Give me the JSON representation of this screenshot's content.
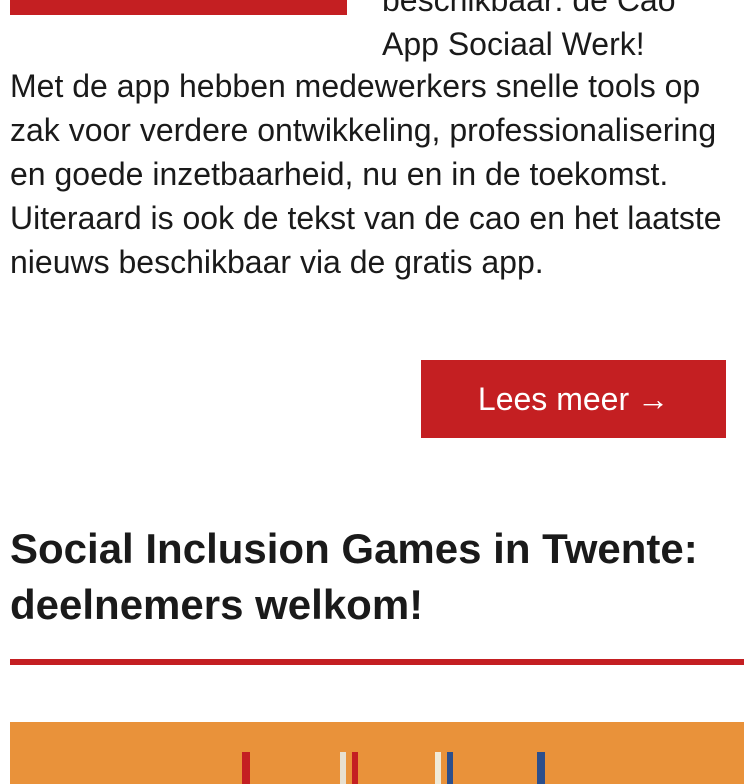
{
  "article_top": {
    "intro_line1": "beschikbaar: de Cao",
    "intro_line2": "App Sociaal Werk!",
    "body": "Met de app hebben medewerkers snelle tools op zak voor verdere ontwikkeling, professionalisering en goede inzetbaarheid, nu en in de toekomst. Uiteraard is ook de tekst van de cao en het laatste nieuws beschikbaar via de gratis app.",
    "read_more_label": "Lees meer",
    "read_more_arrow": "→"
  },
  "article_next": {
    "title": "Social Inclusion Games in Twente: deelnemers welkom!"
  },
  "colors": {
    "accent": "#c41f22",
    "image_bg": "#e9923a"
  },
  "icons": {
    "read_more": "arrow-right-icon"
  }
}
